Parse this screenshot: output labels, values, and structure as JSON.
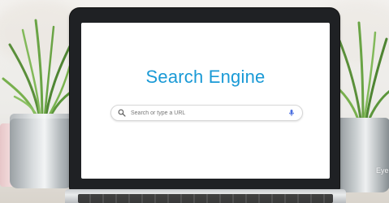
{
  "screen": {
    "title": "Search Engine",
    "search": {
      "placeholder": "Search or type a URL",
      "leading_icon": "search-icon",
      "trailing_icon": "microphone-icon"
    }
  },
  "watermark": {
    "text": "Eye"
  },
  "colors": {
    "title": "#1a9ad6",
    "screen_background": "#ffffff",
    "laptop_bezel": "#1f2124",
    "mic": "#4a6ee0"
  }
}
